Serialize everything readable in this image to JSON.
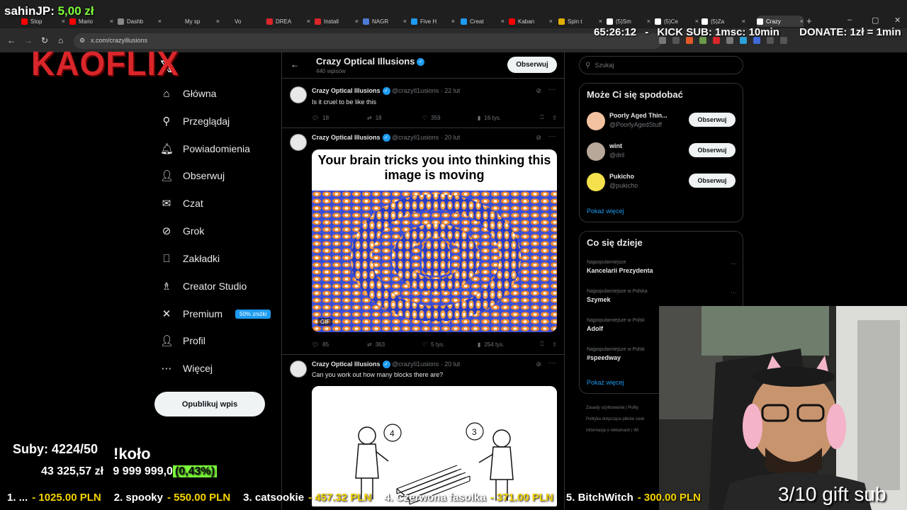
{
  "browser": {
    "tabs": [
      {
        "label": "Stop",
        "color": "#ff0000"
      },
      {
        "label": "Mario",
        "color": "#ff0000"
      },
      {
        "label": "Dashb",
        "color": "#888888"
      },
      {
        "label": "My sp",
        "color": "#1f1f1f"
      },
      {
        "label": "Vo",
        "color": "#1f1f1f"
      },
      {
        "label": "DREA",
        "color": "#d9262a"
      },
      {
        "label": "Install",
        "color": "#d9262a"
      },
      {
        "label": "NAGR",
        "color": "#4a7bd6"
      },
      {
        "label": "Five H",
        "color": "#1d9bf0"
      },
      {
        "label": "Creat",
        "color": "#1d9bf0"
      },
      {
        "label": "Kaban",
        "color": "#ff0000"
      },
      {
        "label": "Spin t",
        "color": "#e0b000"
      },
      {
        "label": "(5)Sm",
        "color": "#ffffff"
      },
      {
        "label": "(5)Ce",
        "color": "#ffffff"
      },
      {
        "label": "(5)Za",
        "color": "#ffffff"
      },
      {
        "label": "Crazy",
        "color": "#ffffff"
      }
    ],
    "url": "x.com/crazyillusions"
  },
  "overlay": {
    "donor_name": "sahinJP:",
    "donor_amount": "5,00 zł",
    "logo": "KAOFLIX",
    "timer": "65:26:12",
    "timer_sep": "-",
    "kick_sub": "KICK SUB: 1msc: 10min",
    "donate": "DONATE: 1zł = 1min",
    "subs": "Suby: 4224/50",
    "wheel": "!koło",
    "money_raised": "43 325,57 zł",
    "money_goal": "9 999 999,0",
    "money_pct": "(0,43%)",
    "ticker": [
      {
        "rank": "1. ...",
        "amount": "- 1025.00 PLN"
      },
      {
        "rank": "2. spooky",
        "amount": "- 550.00 PLN"
      },
      {
        "rank": "3. catsookie",
        "amount": "- 457.32 PLN"
      },
      {
        "rank": "4. Czerwona fasolka",
        "amount": "- 371.00 PLN"
      },
      {
        "rank": "5. BitchWitch",
        "amount": "- 300.00 PLN"
      }
    ],
    "gift": "3/10 gift sub"
  },
  "nav": {
    "items": [
      {
        "label": "Główna",
        "icon": "home-icon",
        "glyph": "⌂"
      },
      {
        "label": "Przeglądaj",
        "icon": "search-icon",
        "glyph": "⚲"
      },
      {
        "label": "Powiadomienia",
        "icon": "bell-icon",
        "glyph": "🔔︎"
      },
      {
        "label": "Obserwuj",
        "icon": "person-add-icon",
        "glyph": "👤︎"
      },
      {
        "label": "Czat",
        "icon": "mail-icon",
        "glyph": "✉"
      },
      {
        "label": "Grok",
        "icon": "grok-icon",
        "glyph": "⊘"
      },
      {
        "label": "Zakładki",
        "icon": "bookmark-icon",
        "glyph": "⎕"
      },
      {
        "label": "Creator Studio",
        "icon": "creator-studio-icon",
        "glyph": "♗"
      },
      {
        "label": "Premium",
        "icon": "x-premium-icon",
        "glyph": "✕",
        "badge": "50% zniżki"
      },
      {
        "label": "Profil",
        "icon": "profile-icon",
        "glyph": "👤︎"
      },
      {
        "label": "Więcej",
        "icon": "more-circle-icon",
        "glyph": "⋯"
      }
    ],
    "post_button": "Opublikuj wpis"
  },
  "profile": {
    "name": "Crazy Optical Illusions",
    "posts": "440 wpisów",
    "follow": "Obserwuj"
  },
  "tweets": [
    {
      "name": "Crazy Optical Illusions",
      "handle": "@crazyIl1usions",
      "date": "· 22 lut",
      "text": "Is it cruel to be like this",
      "replies": "18",
      "reposts": "18",
      "likes": "359",
      "views": "16 tys."
    },
    {
      "name": "Crazy Optical Illusions",
      "handle": "@crazyIl1usions",
      "date": "· 20 lut",
      "text": "",
      "media_caption": "Your brain tricks you into thinking this image is moving",
      "media_tag": "GIF",
      "replies": "85",
      "reposts": "363",
      "likes": "5 tys.",
      "views": "254 tys."
    },
    {
      "name": "Crazy Optical Illusions",
      "handle": "@crazyIl1usions",
      "date": "· 20 lut",
      "text": "Can you work out how many blocks there are?",
      "bubble_left": "4",
      "bubble_right": "3"
    }
  ],
  "sidebar": {
    "search_placeholder": "Szukaj",
    "suggestions_title": "Może Ci się spodobać",
    "suggestions": [
      {
        "name": "Poorly Aged Thin...",
        "handle": "@PoorlyAgedStuff",
        "follow": "Obserwuj",
        "color": "#f2c2a0"
      },
      {
        "name": "wint",
        "handle": "@dril",
        "follow": "Obserwuj",
        "color": "#b8a89a"
      },
      {
        "name": "Pukicho",
        "handle": "@pukicho",
        "follow": "Obserwuj",
        "color": "#f4e04d"
      }
    ],
    "suggestions_more": "Pokaż więcej",
    "trends_title": "Co się dzieje",
    "trends": [
      {
        "category": "Najpopularniejsze",
        "topic": "Kancelarii Prezydenta"
      },
      {
        "category": "Najpopularniejsze w Polska",
        "topic": "Szymek"
      },
      {
        "category": "Najpopularniejsze w Polsk",
        "topic": "Adolf"
      },
      {
        "category": "Najpopularniejsze w Polsk",
        "topic": "#speedway"
      }
    ],
    "trends_more": "Pokaż więcej",
    "footer1": "Zasady użytkowania  |  Polity",
    "footer2": "Polityka dotycząca plików cook",
    "footer3": "Informacja o reklamach  |  Wi"
  },
  "colors": {
    "accent": "#1d9bf0",
    "overlay_green": "#7dff3a",
    "overlay_yellow": "#f5d400",
    "logo_red": "#d9262a"
  }
}
